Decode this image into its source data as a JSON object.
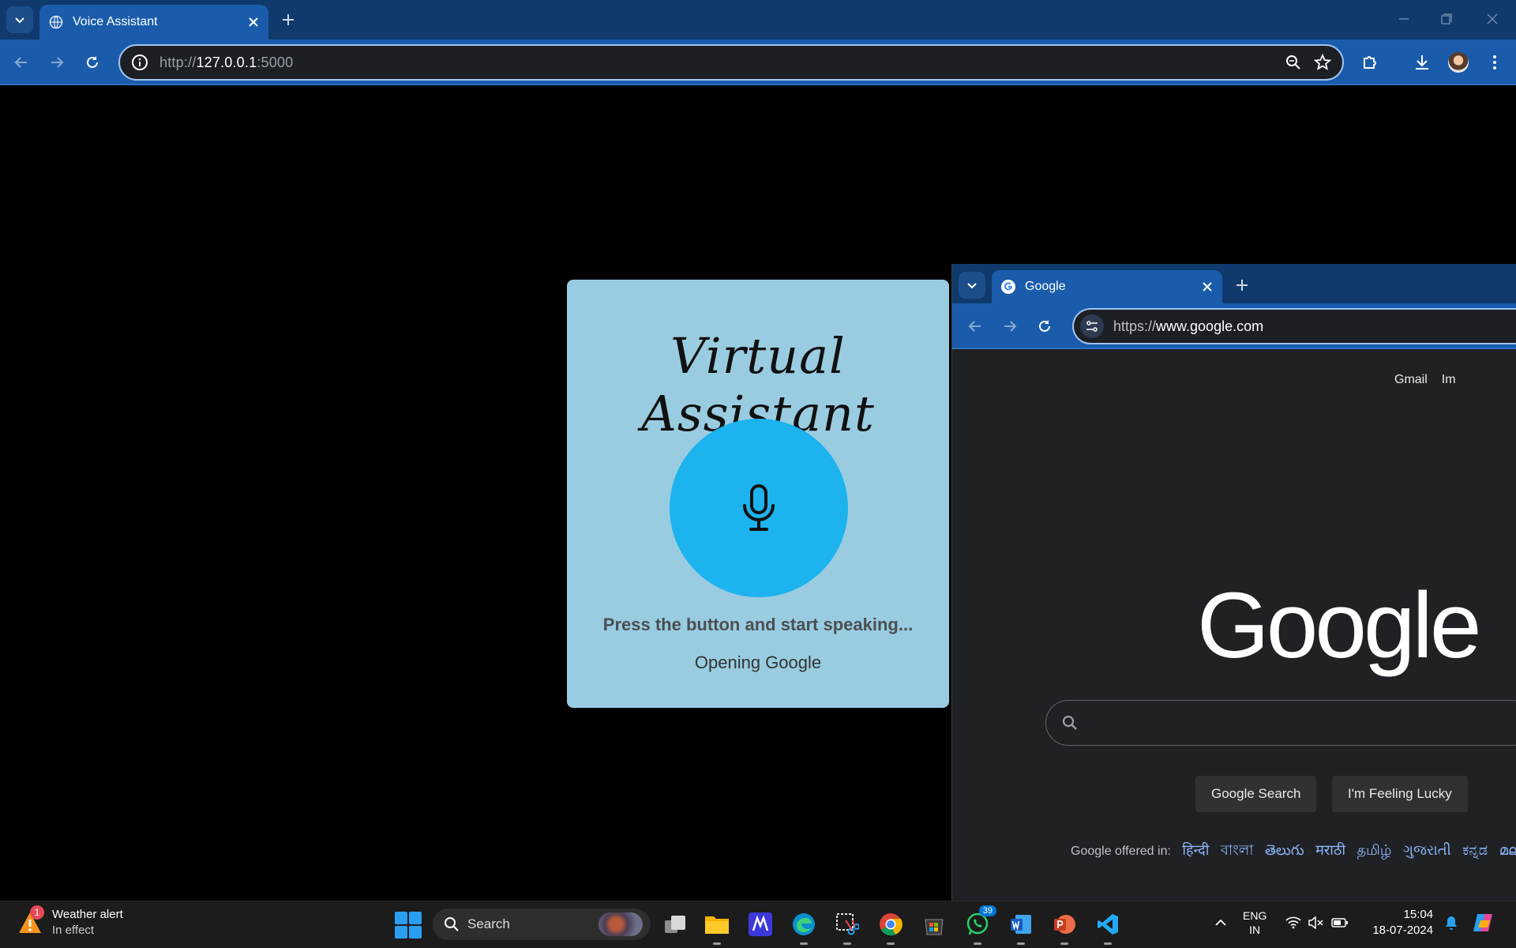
{
  "browser": {
    "tab_title": "Voice Assistant",
    "url_scheme": "http://",
    "url_host": "127.0.0.1",
    "url_port": ":5000"
  },
  "assistant": {
    "title": "Virtual Assistant",
    "prompt": "Press the button and start speaking...",
    "status": "Opening Google",
    "mic_color": "#1cb3ef",
    "card_color": "#99cce0"
  },
  "google_window": {
    "tab_title": "Google",
    "url_scheme": "https://",
    "url_host": "www.google.com",
    "top_links": [
      "Gmail",
      "Im"
    ],
    "logo": "Google",
    "search_button": "Google Search",
    "lucky_button": "I'm Feeling Lucky",
    "offered_label": "Google offered in:",
    "languages": [
      "हिन्दी",
      "বাংলা",
      "తెలుగు",
      "मराठी",
      "தமிழ்",
      "ગુજરાતી",
      "ಕನ್ನಡ",
      "മലാ"
    ]
  },
  "taskbar": {
    "weather_badge": "1",
    "weather_title": "Weather alert",
    "weather_sub": "In effect",
    "search_label": "Search",
    "whatsapp_badge": "39",
    "lang_line1": "ENG",
    "lang_line2": "IN",
    "time": "15:04",
    "date": "18-07-2024"
  }
}
